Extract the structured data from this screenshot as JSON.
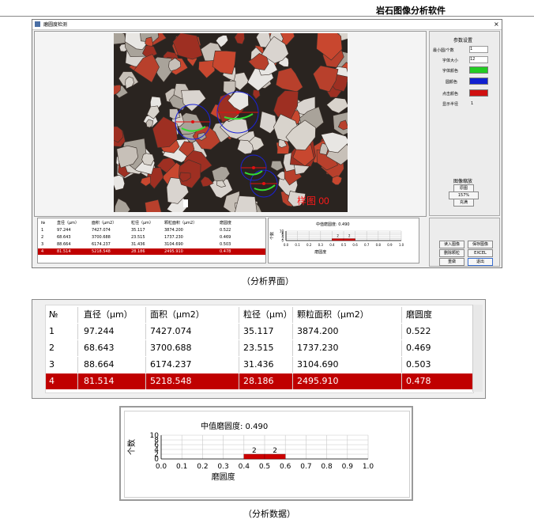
{
  "doc_title": "岩石图像分析软件",
  "window": {
    "title": "磨圆度检测",
    "close_glyph": "×",
    "sample_label": "样图 00",
    "params": {
      "group_title": "参数设置",
      "min_circle_label": "最小圆/个数",
      "min_circle_value": "1",
      "font_size_label": "字体大小",
      "font_size_value": "12",
      "font_color_label": "字体颜色",
      "circle_color_label": "圆颜色",
      "fit_color_label": "点击颜色",
      "show_radius_label": "显示半径",
      "show_radius_value": "1",
      "font_color": "#22cc22",
      "circle_color": "#1020d0",
      "fit_color": "#d01010"
    },
    "zoom": {
      "group_title": "图像缩放",
      "original_label": "原图",
      "zoom_value": "157%",
      "fit_label": "充满"
    },
    "buttons": {
      "load_image": "读入图像",
      "save_image": "保存图像",
      "delete_grain": "删除颗粒",
      "excel": "EXCEL",
      "redo": "重做",
      "exit": "退出"
    },
    "mini_chart_title": "中值磨圆度: 0.490"
  },
  "captions": {
    "ui": "（分析界面）",
    "data": "（分析数据）"
  },
  "table": {
    "headers": [
      "№",
      "直径（μm）",
      "面积（μm2）",
      "粒径（μm）",
      "颗粒面积（μm2）",
      "磨圆度"
    ],
    "rows": [
      [
        "1",
        "97.244",
        "7427.074",
        "35.117",
        "3874.200",
        "0.522"
      ],
      [
        "2",
        "68.643",
        "3700.688",
        "23.515",
        "1737.230",
        "0.469"
      ],
      [
        "3",
        "88.664",
        "6174.237",
        "31.436",
        "3104.690",
        "0.503"
      ],
      [
        "4",
        "81.514",
        "5218.548",
        "28.186",
        "2495.910",
        "0.478"
      ]
    ],
    "selected_row": 4,
    "selected_color": "#c00000"
  },
  "chart_data": {
    "type": "bar",
    "title": "中值磨圆度: 0.490",
    "xlabel": "磨圆度",
    "ylabel": "个数",
    "x_ticks": [
      "0.0",
      "0.1",
      "0.2",
      "0.3",
      "0.4",
      "0.5",
      "0.6",
      "0.7",
      "0.8",
      "0.9",
      "1.0"
    ],
    "y_ticks": [
      "0",
      "2",
      "4",
      "6",
      "8",
      "10"
    ],
    "xlim": [
      0,
      1
    ],
    "ylim": [
      0,
      10
    ],
    "bins": [
      {
        "from": 0.4,
        "to": 0.5,
        "value": 2
      },
      {
        "from": 0.5,
        "to": 0.6,
        "value": 2
      }
    ],
    "bar_color": "#cc0000",
    "grid": true
  }
}
